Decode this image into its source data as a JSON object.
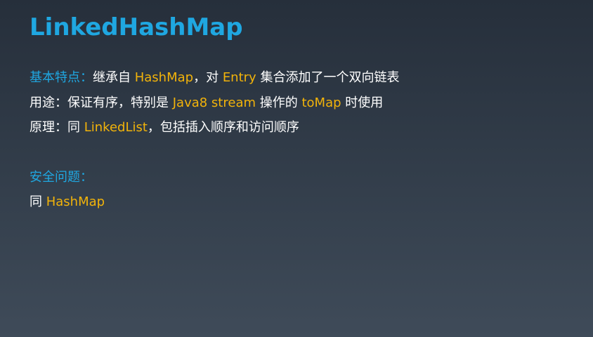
{
  "title": "LinkedHashMap",
  "features": {
    "label": "基本特点：",
    "t1": "继承自 ",
    "k1": "HashMap",
    "t2": "，对 ",
    "k2": "Entry",
    "t3": " 集合添加了一个双向链表"
  },
  "usage": {
    "label": "用途：",
    "t1": "保证有序，特别是 ",
    "k1": "Java8 stream",
    "t2": " 操作的 ",
    "k2": "toMap",
    "t3": " 时使用"
  },
  "principle": {
    "label": "原理：",
    "t1": "同 ",
    "k1": "LinkedList",
    "t2": "，包括插入顺序和访问顺序"
  },
  "safety": {
    "heading": "安全问题：",
    "t1": "同 ",
    "k1": "HashMap"
  },
  "colors": {
    "heading_blue": "#1fa7e1",
    "keyword_yellow": "#f2b30a",
    "text_white": "#ffffff",
    "background_top": "#262f3b",
    "background_bottom": "#3f4b59"
  }
}
